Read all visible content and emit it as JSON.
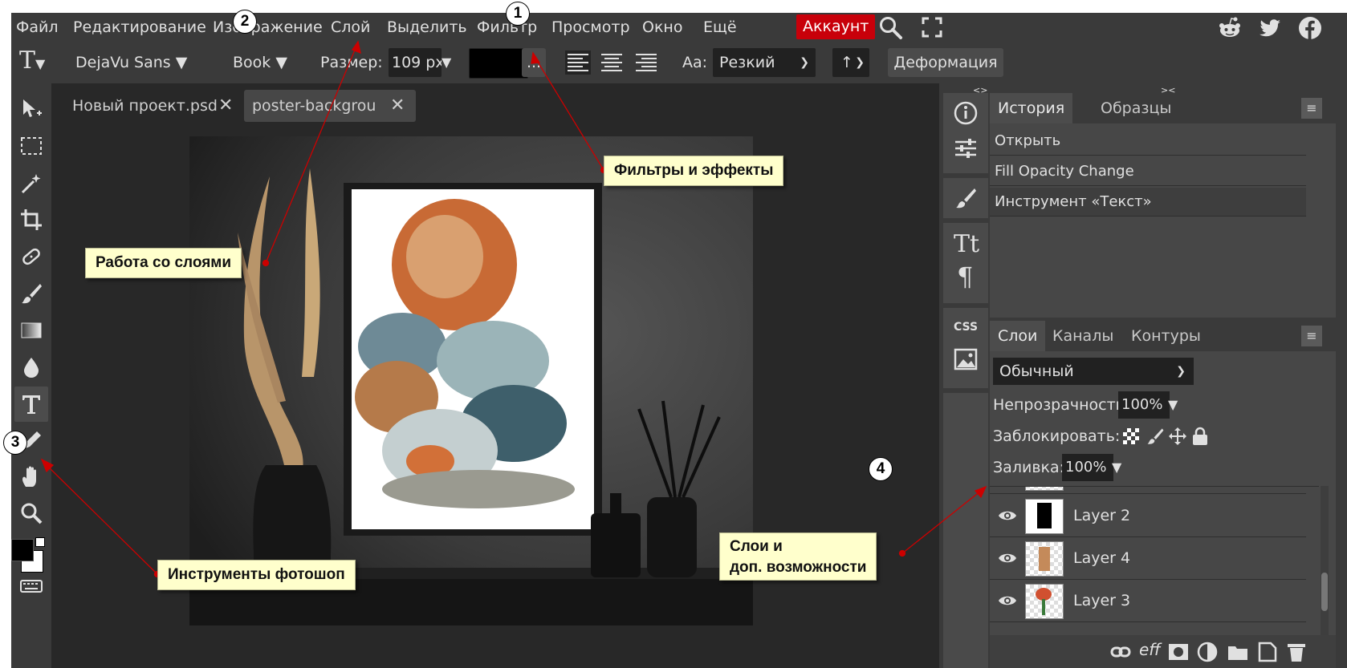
{
  "menu": {
    "items": [
      "Файл",
      "Редактирование",
      "Изображение",
      "Слой",
      "Выделить",
      "Фильтр",
      "Просмотр",
      "Окно",
      "Ещё"
    ],
    "account": "Аккаунт",
    "colors": {
      "account_bg": "#c8000a"
    }
  },
  "options": {
    "font_family": "DejaVu Sans",
    "font_style": "Book",
    "size_label": "Размер:",
    "size_value": "109 px",
    "more_button": "...",
    "aa_label": "Aa:",
    "aa_value": "Резкий",
    "orientation_value": "↑",
    "warp_button": "Деформация",
    "text_color": "#000000"
  },
  "tabs": [
    {
      "label": "Новый проект.psd",
      "close": "✕"
    },
    {
      "label": "poster-backgrou *",
      "close": "✕"
    }
  ],
  "toggles": {
    "left": "<>",
    "right": "><"
  },
  "history_panel": {
    "tabs": [
      "История",
      "Образцы"
    ],
    "items": [
      "Открыть",
      "Fill Opacity Change",
      "Инструмент «Текст»"
    ]
  },
  "layers_panel": {
    "tabs": [
      "Слои",
      "Каналы",
      "Контуры"
    ],
    "blend_mode": "Обычный",
    "opacity_label": "Непрозрачность:",
    "opacity_value": "100%",
    "lock_label": "Заблокировать:",
    "fill_label": "Заливка:",
    "fill_value": "100%",
    "layers": [
      {
        "name": "Layer 2"
      },
      {
        "name": "Layer 4"
      },
      {
        "name": "Layer 3"
      }
    ],
    "bottom_icons": [
      "link-icon",
      "effects-icon",
      "mask-icon",
      "adjustment-icon",
      "folder-icon",
      "new-layer-icon",
      "trash-icon"
    ]
  },
  "side_strip": {
    "css_label": "CSS"
  },
  "callouts": {
    "filters": "Фильтры и эффекты",
    "layers_work": "Работа со слоями",
    "tools": "Инструменты фотошоп",
    "layers_extra_1": "Слои и",
    "layers_extra_2": "доп. возможности"
  },
  "markers": [
    "1",
    "2",
    "3",
    "4"
  ],
  "annotation_color": "#cc0000"
}
